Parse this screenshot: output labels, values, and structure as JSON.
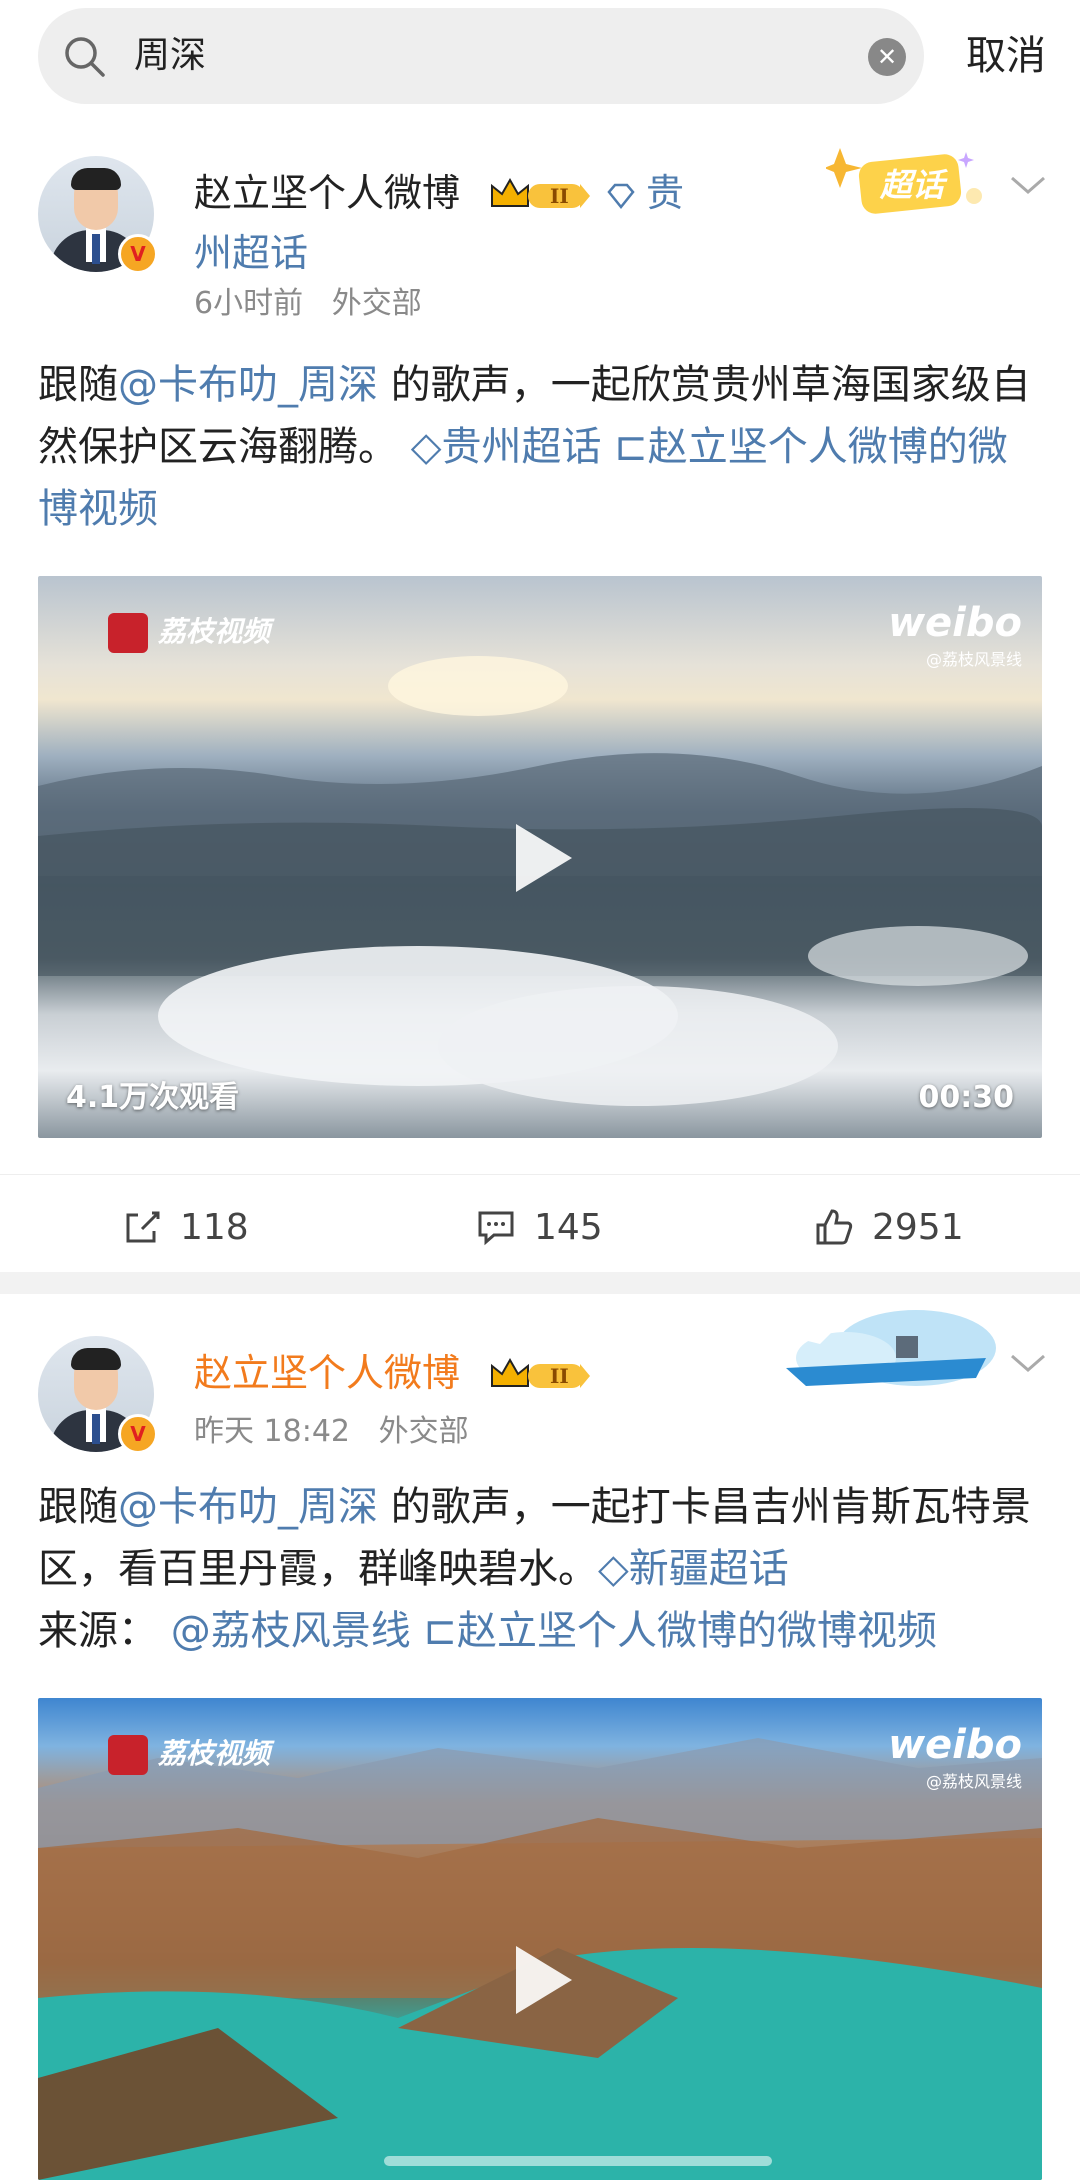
{
  "search": {
    "query": "周深",
    "cancel_label": "取消"
  },
  "posts": [
    {
      "author": "赵立坚个人微博",
      "level_badge": "II",
      "topic_tag": "贵州超话",
      "super_topic_sticker": "超话",
      "time": "6小时前",
      "source": "外交部",
      "text_prefix": "跟随",
      "mention": "@卡布叻_周深",
      "text_body": " 的歌声，一起欣赏贵州草海国家级自然保护区云海翻腾。",
      "topic_link": "贵州超话",
      "video_link": "赵立坚个人微博的微博视频",
      "video": {
        "views": "4.1万次观看",
        "duration": "00:30",
        "brand_left": "荔枝视频",
        "brand_right": "weibo",
        "brand_right_sub": "@荔枝风景线"
      },
      "actions": {
        "repost": "118",
        "comment": "145",
        "like": "2951"
      }
    },
    {
      "author": "赵立坚个人微博",
      "level_badge": "II",
      "time": "昨天 18:42",
      "source": "外交部",
      "text_prefix": "跟随",
      "mention": "@卡布叻_周深",
      "text_body": " 的歌声，一起打卡昌吉州肯斯瓦特景区，看百里丹霞，群峰映碧水。",
      "topic_link": "新疆超话",
      "source_label": "来源：",
      "source_mention": "@荔枝风景线",
      "video_link": "赵立坚个人微博的微博视频",
      "video": {
        "brand_left": "荔枝视频",
        "brand_right": "weibo",
        "brand_right_sub": "@荔枝风景线"
      }
    }
  ],
  "colors": {
    "link": "#4f7cae",
    "vip_name": "#f27b1d",
    "meta": "#8a8a8a"
  }
}
